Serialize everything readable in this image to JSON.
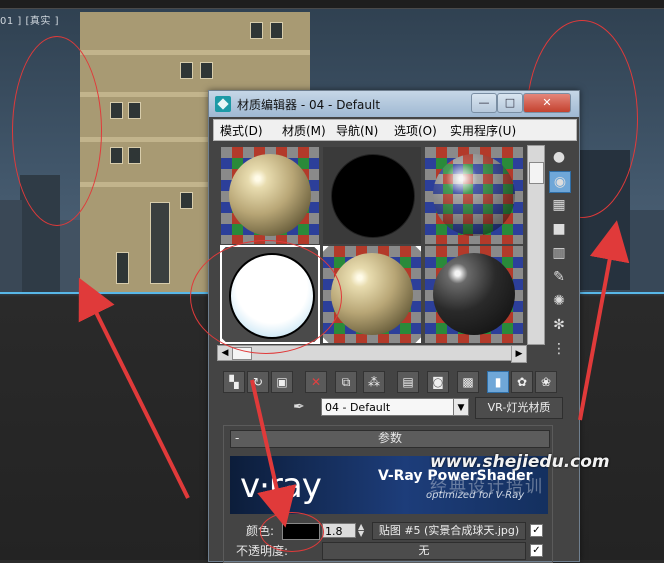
{
  "viewport": {
    "label": "01 ] [真实 ]"
  },
  "dialog": {
    "title": "材质编辑器 - 04 - Default",
    "window_buttons": [
      "—",
      "□",
      "✕"
    ],
    "menu": [
      "模式(D)",
      "材质(M)",
      "导航(N)",
      "选项(O)",
      "实用程序(U)"
    ],
    "slots": [
      {
        "type": "tan-sphere"
      },
      {
        "type": "black-sphere"
      },
      {
        "type": "checker-sphere"
      },
      {
        "type": "light-sphere",
        "selected": true
      },
      {
        "type": "tan-sphere"
      },
      {
        "type": "dark-gloss-sphere"
      }
    ],
    "side_tools": [
      "sphere-icon",
      "cylinder-icon",
      "checker-bg-icon",
      "backlight-icon",
      "uv-tiling-icon",
      "video-check-icon",
      "preview-icon",
      "options-icon",
      "select-by-material-icon",
      "navigator-icon"
    ],
    "bottom_tools": [
      "get-material-icon",
      "put-to-scene-icon",
      "assign-to-selection-icon",
      "reset-map-icon",
      "copy-material-icon",
      "make-unique-icon",
      "put-to-library-icon",
      "material-effects-channel-icon",
      "show-map-icon",
      "show-end-result-icon",
      "go-to-parent-icon",
      "go-forward-to-sibling-icon"
    ],
    "material_name": "04 - Default",
    "material_type": "VR-灯光材质",
    "rollout_title": "参数",
    "vray_banner": {
      "logo": "v·ray",
      "title": "V-Ray PowerShader",
      "subtitle": "optimized for V-Ray"
    },
    "color_label": "颜色:",
    "multiplier": "1.8",
    "color_map": "贴图 #5 (实景合成球天.jpg)",
    "opacity_label": "不透明度:",
    "opacity_map": "无"
  },
  "watermark": {
    "url": "www.shejiedu.com",
    "text": "经典设计培训"
  },
  "colors": {
    "annotation": "#e03a3a",
    "active_tool": "#6fa7d8",
    "titlebar": "#b7cbe0"
  }
}
